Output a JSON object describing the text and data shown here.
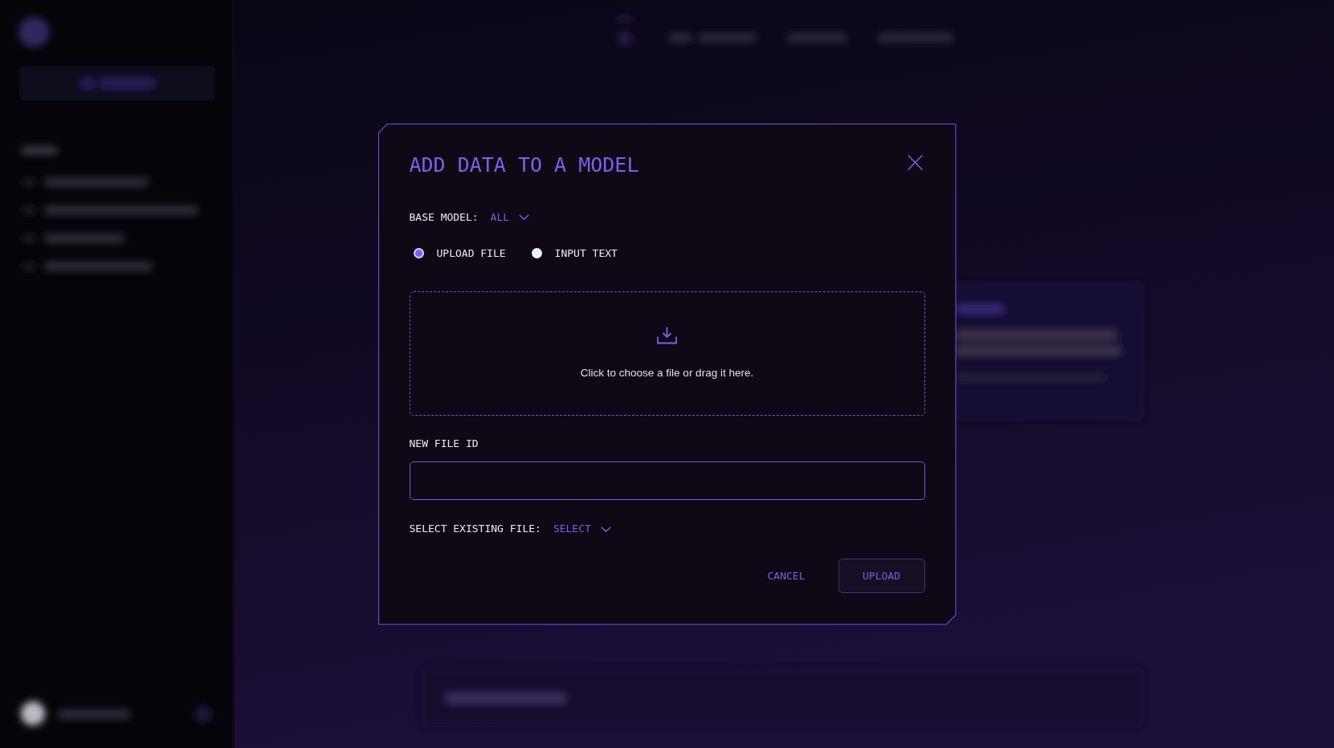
{
  "dialog": {
    "title": "ADD DATA TO A MODEL",
    "base_model": {
      "label": "BASE MODEL:",
      "value": "ALL"
    },
    "source_options": [
      {
        "label": "UPLOAD FILE",
        "selected": true
      },
      {
        "label": "INPUT TEXT",
        "selected": false
      }
    ],
    "dropzone": {
      "text": "Click to choose a file or drag it here."
    },
    "new_file_id": {
      "label": "NEW FILE ID"
    },
    "existing_file": {
      "label": "SELECT EXISTING FILE:",
      "value": "SELECT"
    },
    "buttons": [
      {
        "label": "CANCEL",
        "kind": "text"
      },
      {
        "label": "UPLOAD",
        "kind": "outlined"
      }
    ]
  }
}
